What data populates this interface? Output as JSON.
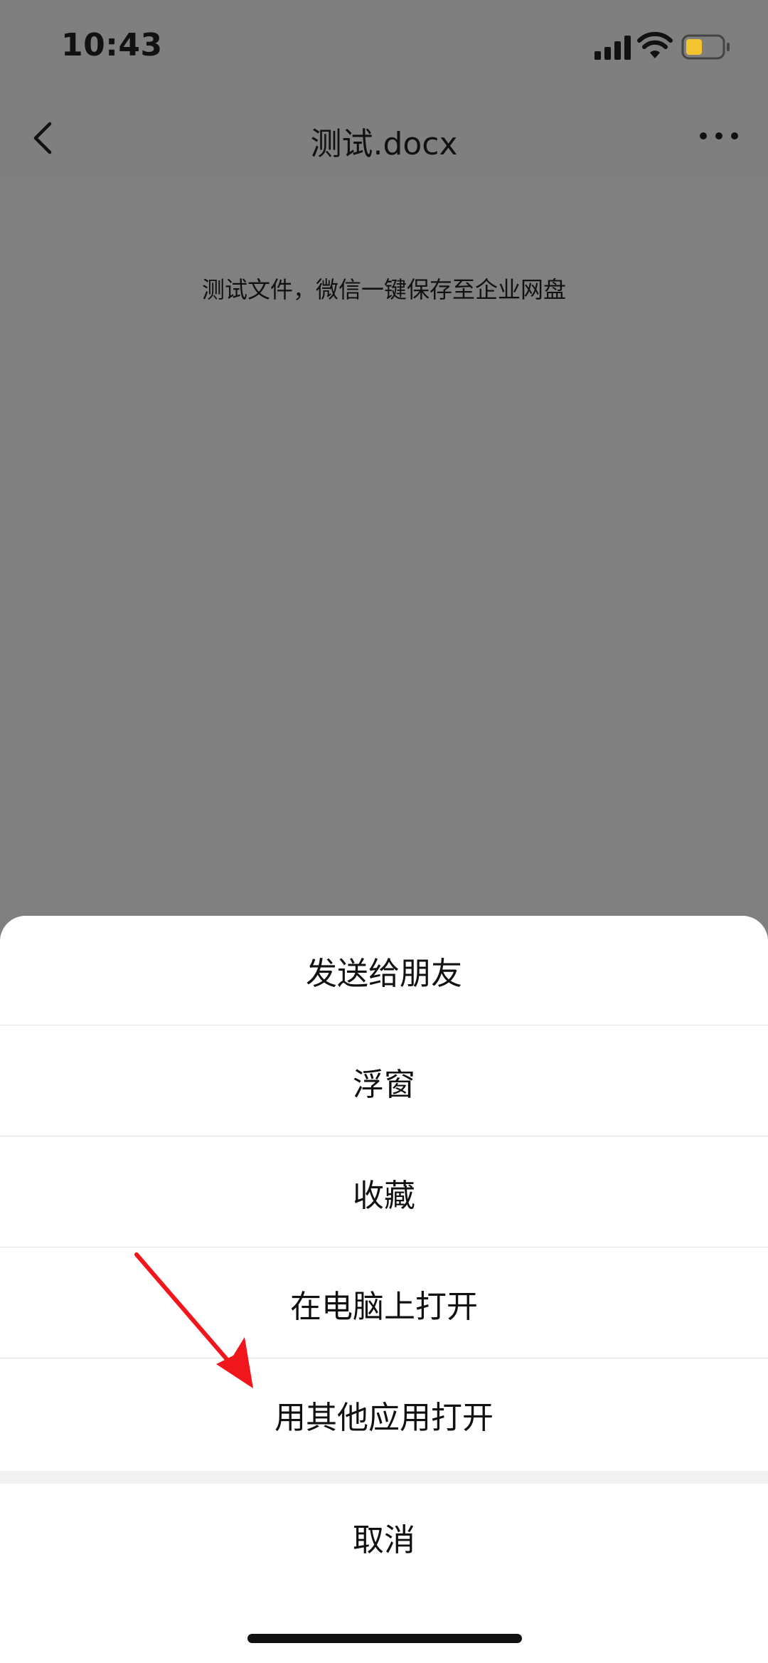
{
  "status_bar": {
    "time": "10:43"
  },
  "nav": {
    "title": "测试.docx"
  },
  "document": {
    "text": "测试文件，微信一键保存至企业网盘"
  },
  "sheet": {
    "items": [
      {
        "label": "发送给朋友"
      },
      {
        "label": "浮窗"
      },
      {
        "label": "收藏"
      },
      {
        "label": "在电脑上打开"
      },
      {
        "label": "用其他应用打开"
      }
    ],
    "cancel_label": "取消"
  },
  "colors": {
    "overlay": "#808080",
    "sheet_bg": "#ffffff",
    "arrow": "#f0161c"
  },
  "icons": [
    "signal-icon",
    "wifi-icon",
    "battery-icon",
    "back-icon",
    "more-icon",
    "arrow-annotation"
  ]
}
